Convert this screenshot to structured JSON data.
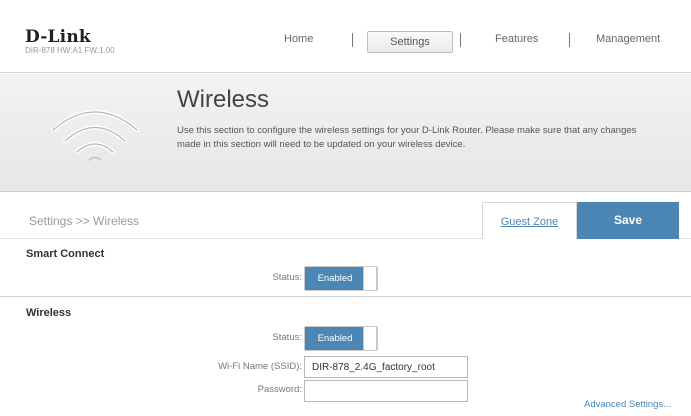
{
  "brand": {
    "logo": "D-Link",
    "model": "DIR-878 HW:A1 FW:1.00"
  },
  "nav": {
    "home": "Home",
    "settings": "Settings",
    "features": "Features",
    "management": "Management"
  },
  "banner": {
    "title": "Wireless",
    "description": "Use this section to configure the wireless settings for your D-Link Router. Please make sure that any changes made in this section will need to be updated on your wireless device.",
    "icon": "wifi-icon"
  },
  "breadcrumb": "Settings >> Wireless",
  "actions": {
    "guest_zone": "Guest Zone",
    "save": "Save"
  },
  "smart_connect": {
    "title": "Smart Connect",
    "status_label": "Status:",
    "status_value": "Enabled"
  },
  "wireless": {
    "title": "Wireless",
    "status_label": "Status:",
    "status_value": "Enabled",
    "ssid_label": "Wi-Fi Name (SSID):",
    "ssid_value": "DIR-878_2.4G_factory_root",
    "password_label": "Password:",
    "password_value": "",
    "advanced_link": "Advanced Settings..."
  },
  "colors": {
    "accent": "#4b86b4",
    "banner_bg": "#ececec"
  }
}
